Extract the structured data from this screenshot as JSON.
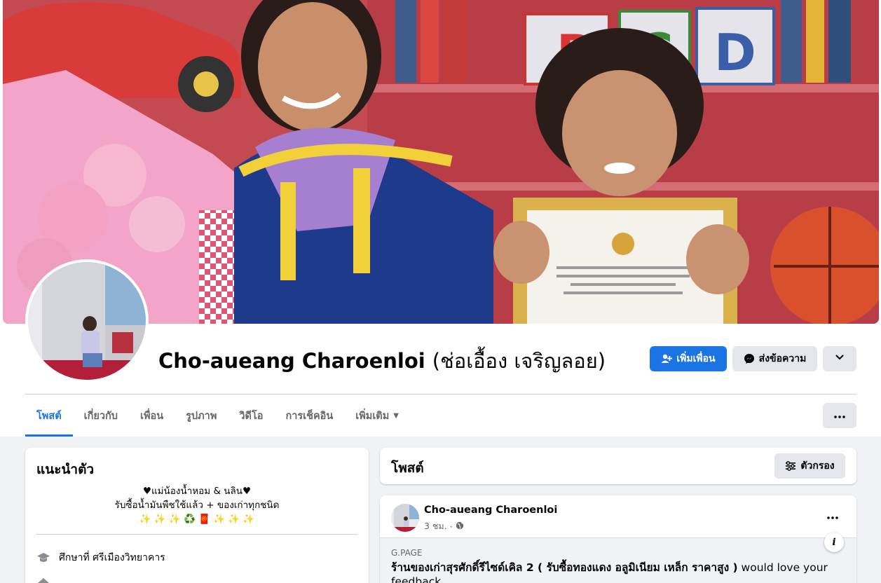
{
  "profile": {
    "name": "Cho-aueang Charoenloi",
    "alt_name": "(ช่อเอื้อง เจริญลอย)"
  },
  "actions": {
    "add_friend": "เพิ่มเพื่อน",
    "message": "ส่งข้อความ"
  },
  "tabs": [
    {
      "label": "โพสต์",
      "active": true
    },
    {
      "label": "เกี่ยวกับ"
    },
    {
      "label": "เพื่อน"
    },
    {
      "label": "รูปภาพ"
    },
    {
      "label": "วิดีโอ"
    },
    {
      "label": "การเช็คอิน"
    },
    {
      "label": "เพิ่มเติม"
    }
  ],
  "intro": {
    "title": "แนะนำตัว",
    "bio_line1": "♥แม่น้องน้ำหอม & นลิน♥",
    "bio_line2": "รับซื้อน้ำมันพืชใช้แล้ว + ของเก่าทุกชนิด",
    "bio_line3": "✨ ✨ ✨ ♻️ 🧧 ✨ ✨ ✨",
    "education": "ศึกษาที่ ศรีเมืองวิทยาคาร"
  },
  "posts": {
    "title": "โพสต์",
    "filter_label": "ตัวกรอง"
  },
  "post": {
    "author": "Cho-aueang Charoenloi",
    "time": "3 ชม.",
    "link_domain": "G.PAGE",
    "link_title_bold": "ร้านของเก่าสุรศักดิ์รีไซด์เคิล 2 ( รับซื้อทองแดง อลูมิเนียม เหล็ก ราคาสูง )",
    "link_title_rest": " would love your feedback"
  },
  "colors": {
    "accent": "#1b74e4",
    "page_bg": "#f0f2f5"
  }
}
